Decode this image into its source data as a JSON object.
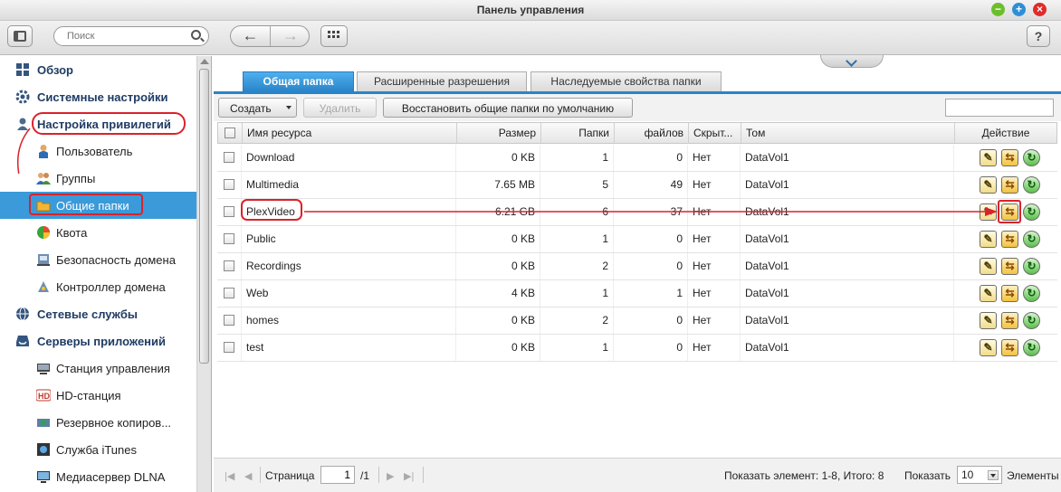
{
  "window": {
    "title": "Панель управления"
  },
  "toolbar": {
    "search_placeholder": "Поиск",
    "help_label": "?"
  },
  "sidebar": {
    "items": [
      {
        "label": "Обзор",
        "kind": "cat",
        "icon": "overview-icon"
      },
      {
        "label": "Системные настройки",
        "kind": "cat",
        "icon": "gear-icon"
      },
      {
        "label": "Настройка привилегий",
        "kind": "cat",
        "icon": "user-icon"
      },
      {
        "label": "Пользователь",
        "kind": "sub",
        "icon": "user-icon"
      },
      {
        "label": "Группы",
        "kind": "sub",
        "icon": "group-icon"
      },
      {
        "label": "Общие папки",
        "kind": "sub",
        "icon": "shared-folder-icon",
        "selected": true
      },
      {
        "label": "Квота",
        "kind": "sub",
        "icon": "quota-icon"
      },
      {
        "label": "Безопасность домена",
        "kind": "sub",
        "icon": "domain-security-icon"
      },
      {
        "label": "Контроллер домена",
        "kind": "sub",
        "icon": "domain-controller-icon"
      },
      {
        "label": "Сетевые службы",
        "kind": "cat",
        "icon": "globe-icon"
      },
      {
        "label": "Серверы приложений",
        "kind": "cat",
        "icon": "inbox-icon"
      },
      {
        "label": "Станция управления",
        "kind": "sub",
        "icon": "station-icon"
      },
      {
        "label": "HD-станция",
        "kind": "sub",
        "icon": "hd-icon"
      },
      {
        "label": "Резервное копиров...",
        "kind": "sub",
        "icon": "backup-icon"
      },
      {
        "label": "Служба iTunes",
        "kind": "sub",
        "icon": "itunes-icon"
      },
      {
        "label": "Медиасервер DLNA",
        "kind": "sub",
        "icon": "monitor-icon"
      }
    ]
  },
  "tabs": [
    {
      "label": "Общая папка",
      "active": true
    },
    {
      "label": "Расширенные разрешения",
      "active": false
    },
    {
      "label": "Наследуемые свойства папки",
      "active": false
    }
  ],
  "actions": {
    "create": "Создать",
    "delete": "Удалить",
    "restore": "Восстановить общие папки по умолчанию"
  },
  "table": {
    "columns": {
      "name": "Имя ресурса",
      "size": "Размер",
      "folders": "Папки",
      "files": "файлов",
      "hidden": "Скрыт...",
      "volume": "Том",
      "action": "Действие"
    },
    "rows": [
      {
        "name": "Download",
        "size": "0 KB",
        "folders": "1",
        "files": "0",
        "hidden": "Нет",
        "volume": "DataVol1"
      },
      {
        "name": "Multimedia",
        "size": "7.65 MB",
        "folders": "5",
        "files": "49",
        "hidden": "Нет",
        "volume": "DataVol1"
      },
      {
        "name": "PlexVideo",
        "size": "6.21 GB",
        "folders": "6",
        "files": "37",
        "hidden": "Нет",
        "volume": "DataVol1"
      },
      {
        "name": "Public",
        "size": "0 KB",
        "folders": "1",
        "files": "0",
        "hidden": "Нет",
        "volume": "DataVol1"
      },
      {
        "name": "Recordings",
        "size": "0 KB",
        "folders": "2",
        "files": "0",
        "hidden": "Нет",
        "volume": "DataVol1"
      },
      {
        "name": "Web",
        "size": "4 KB",
        "folders": "1",
        "files": "1",
        "hidden": "Нет",
        "volume": "DataVol1"
      },
      {
        "name": "homes",
        "size": "0 KB",
        "folders": "2",
        "files": "0",
        "hidden": "Нет",
        "volume": "DataVol1"
      },
      {
        "name": "test",
        "size": "0 KB",
        "folders": "1",
        "files": "0",
        "hidden": "Нет",
        "volume": "DataVol1"
      }
    ]
  },
  "pager": {
    "page_label": "Страница",
    "page_value": "1",
    "page_total": "/1",
    "summary": "Показать элемент: 1-8, Итого: 8",
    "show_label": "Показать",
    "per_page": "10",
    "items_label": "Элементы"
  },
  "colors": {
    "accent": "#2a84c8",
    "selection": "#3b9ad9",
    "annotation": "#d8232a",
    "category_text": "#1f3b64"
  }
}
